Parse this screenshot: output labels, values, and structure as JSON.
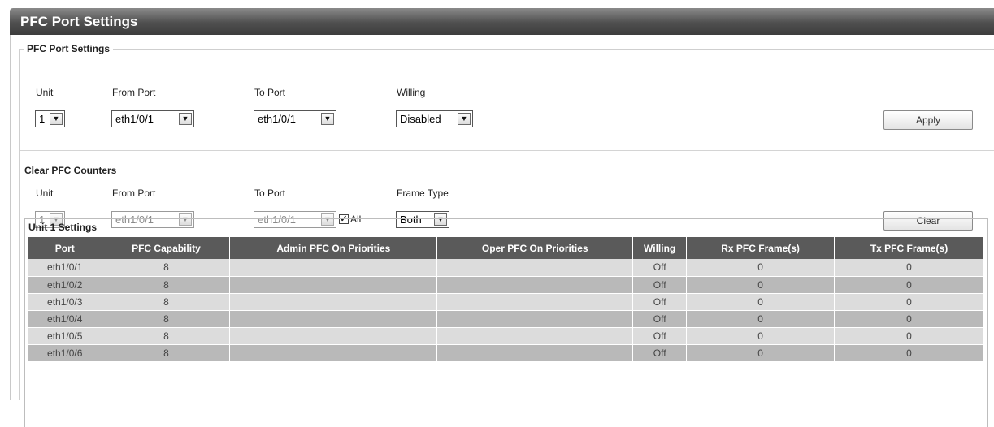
{
  "page_title": "PFC Port Settings",
  "settings": {
    "legend": "PFC Port Settings",
    "unit_label": "Unit",
    "unit_value": "1",
    "from_port_label": "From Port",
    "from_port_value": "eth1/0/1",
    "to_port_label": "To Port",
    "to_port_value": "eth1/0/1",
    "willing_label": "Willing",
    "willing_value": "Disabled",
    "apply_label": "Apply"
  },
  "clear": {
    "title": "Clear PFC Counters",
    "unit_label": "Unit",
    "unit_value": "1",
    "from_port_label": "From Port",
    "from_port_value": "eth1/0/1",
    "to_port_label": "To Port",
    "to_port_value": "eth1/0/1",
    "all_label": "All",
    "all_checked": true,
    "frame_type_label": "Frame Type",
    "frame_type_value": "Both",
    "clear_label": "Clear"
  },
  "table": {
    "title": "Unit 1 Settings",
    "headers": [
      "Port",
      "PFC Capability",
      "Admin PFC On Priorities",
      "Oper PFC On Priorities",
      "Willing",
      "Rx PFC Frame(s)",
      "Tx PFC Frame(s)"
    ],
    "rows": [
      [
        "eth1/0/1",
        "8",
        "",
        "",
        "Off",
        "0",
        "0"
      ],
      [
        "eth1/0/2",
        "8",
        "",
        "",
        "Off",
        "0",
        "0"
      ],
      [
        "eth1/0/3",
        "8",
        "",
        "",
        "Off",
        "0",
        "0"
      ],
      [
        "eth1/0/4",
        "8",
        "",
        "",
        "Off",
        "0",
        "0"
      ],
      [
        "eth1/0/5",
        "8",
        "",
        "",
        "Off",
        "0",
        "0"
      ],
      [
        "eth1/0/6",
        "8",
        "",
        "",
        "Off",
        "0",
        "0"
      ]
    ]
  },
  "icons": {
    "dropdown": "chevron-down-icon",
    "checkbox": "checkmark-icon"
  }
}
